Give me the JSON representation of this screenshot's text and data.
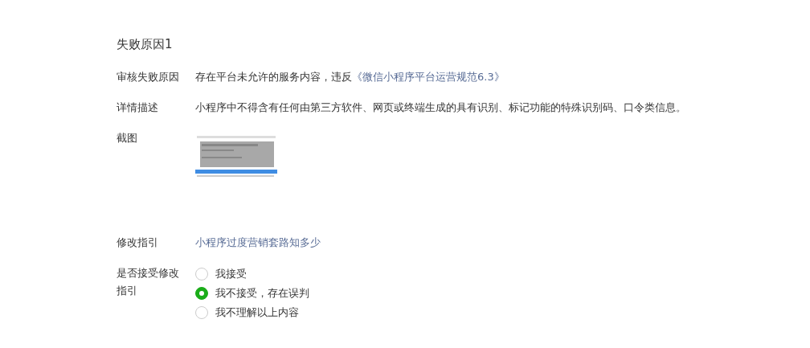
{
  "title": "失败原因1",
  "reason": {
    "label": "审核失败原因",
    "text": "存在平台未允许的服务内容，违反",
    "link": "《微信小程序平台运营规范6.3》"
  },
  "detail": {
    "label": "详情描述",
    "text": "小程序中不得含有任何由第三方软件、网页或终端生成的具有识别、标记功能的特殊识别码、口令类信息。"
  },
  "screenshot": {
    "label": "截图",
    "kind": "picture"
  },
  "guide": {
    "label": "修改指引",
    "link": "小程序过度营销套路知多少"
  },
  "accept": {
    "label": "是否接受修改指引",
    "options": [
      {
        "label": "我接受",
        "selected": false
      },
      {
        "label": "我不接受，存在误判",
        "selected": true
      },
      {
        "label": "我不理解以上内容",
        "selected": false
      }
    ]
  }
}
